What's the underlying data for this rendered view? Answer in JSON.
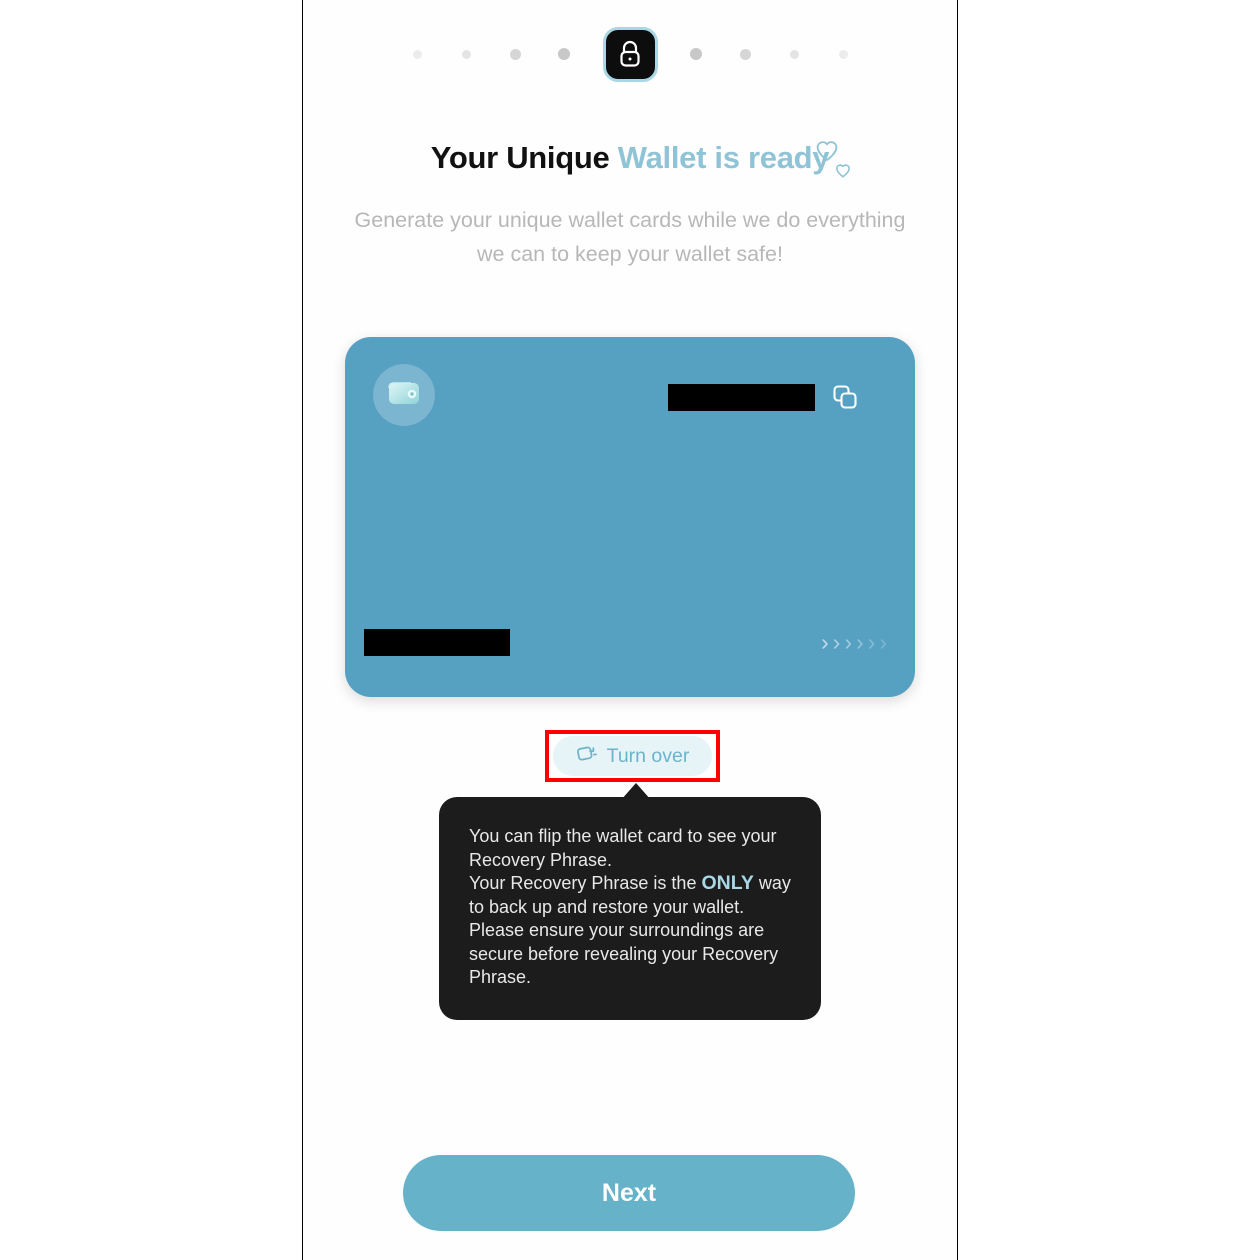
{
  "screen": {
    "title_prefix": "Your Unique",
    "title_accent": "Wallet is ready",
    "subtitle": "Generate your unique wallet cards while we do everything we can to keep your wallet safe!"
  },
  "step_indicator": {
    "current_icon": "lock-icon",
    "current_step": 5,
    "total_steps": 9,
    "dots_left": [
      {
        "size": 9,
        "opacity": 0.18
      },
      {
        "size": 9,
        "opacity": 0.26
      },
      {
        "size": 11,
        "opacity": 0.4
      },
      {
        "size": 12,
        "opacity": 0.55
      }
    ],
    "dots_right": [
      {
        "size": 12,
        "opacity": 0.55
      },
      {
        "size": 11,
        "opacity": 0.4
      },
      {
        "size": 9,
        "opacity": 0.26
      },
      {
        "size": 9,
        "opacity": 0.18
      }
    ]
  },
  "wallet_card": {
    "icon": "wallet-icon",
    "address_value": "",
    "address_redacted": true,
    "copy_icon": "copy-icon",
    "name_value": "",
    "name_redacted": true,
    "chevrons": [
      ">",
      ">",
      ">",
      ">",
      ">",
      ">"
    ],
    "chevron_opacities": [
      0.62,
      0.52,
      0.44,
      0.36,
      0.28,
      0.22
    ],
    "background_color": "#56a0c2"
  },
  "turn_over": {
    "label": "Turn over",
    "icon": "flip-card-icon",
    "highlight_color": "#ff0000",
    "background_color": "#e6f3f7",
    "text_color": "#6cb4cc"
  },
  "tooltip": {
    "line1": "You can flip the wallet card to see your Recovery Phrase.",
    "line2_before": "Your Recovery Phrase is the ",
    "line2_emphasis": "ONLY",
    "line2_after": " way to back up and restore your wallet.",
    "line3": "Please ensure your surroundings are secure before revealing your Recovery Phrase.",
    "background_color": "#1c1c1c",
    "emphasis_color": "#a8d8e6"
  },
  "footer": {
    "next_label": "Next",
    "next_color": "#66b2c8"
  },
  "colors": {
    "accent": "#8fc3d6",
    "card": "#56a0c2",
    "muted_text": "#b7b7b7",
    "dark": "#111111"
  }
}
